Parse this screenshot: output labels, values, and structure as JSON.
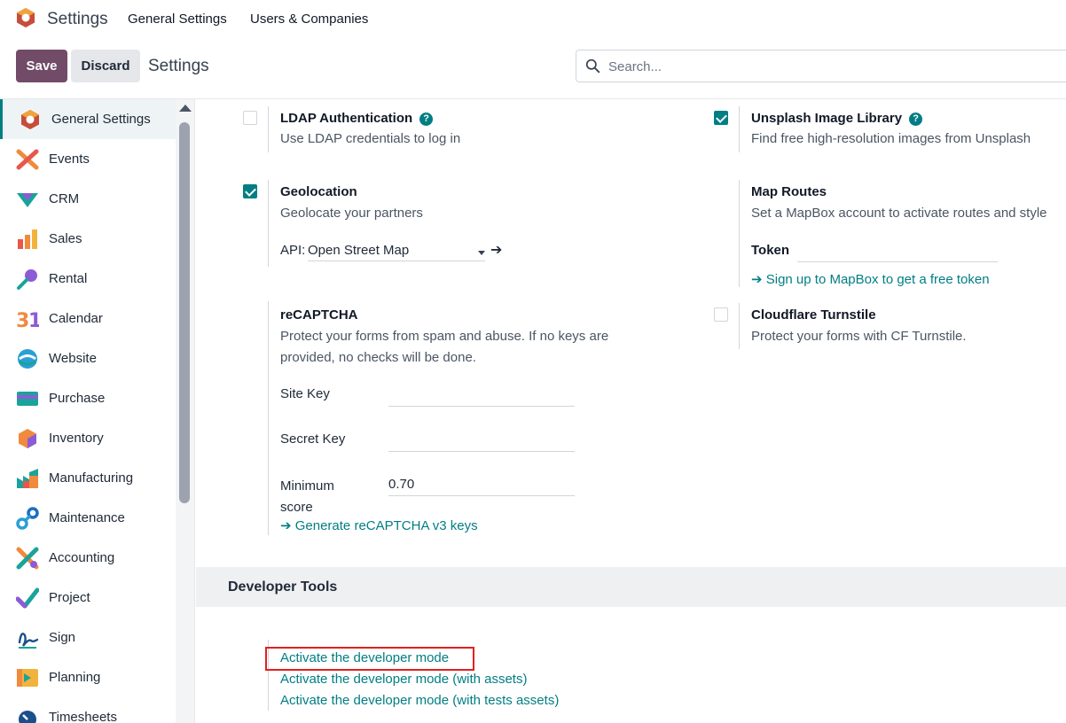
{
  "topnav": {
    "app_title": "Settings",
    "menu": [
      "General Settings",
      "Users & Companies"
    ]
  },
  "control_panel": {
    "save_label": "Save",
    "discard_label": "Discard",
    "breadcrumb": "Settings",
    "search_placeholder": "Search..."
  },
  "sidebar": {
    "items": [
      {
        "label": "General Settings",
        "icon": "settings-icon",
        "active": true
      },
      {
        "label": "Events",
        "icon": "events-icon"
      },
      {
        "label": "CRM",
        "icon": "crm-icon"
      },
      {
        "label": "Sales",
        "icon": "sales-icon"
      },
      {
        "label": "Rental",
        "icon": "rental-icon"
      },
      {
        "label": "Calendar",
        "icon": "calendar-icon"
      },
      {
        "label": "Website",
        "icon": "website-icon"
      },
      {
        "label": "Purchase",
        "icon": "purchase-icon"
      },
      {
        "label": "Inventory",
        "icon": "inventory-icon"
      },
      {
        "label": "Manufacturing",
        "icon": "manufacturing-icon"
      },
      {
        "label": "Maintenance",
        "icon": "maintenance-icon"
      },
      {
        "label": "Accounting",
        "icon": "accounting-icon"
      },
      {
        "label": "Project",
        "icon": "project-icon"
      },
      {
        "label": "Sign",
        "icon": "sign-icon"
      },
      {
        "label": "Planning",
        "icon": "planning-icon"
      },
      {
        "label": "Timesheets",
        "icon": "timesheets-icon"
      }
    ]
  },
  "settings": {
    "ldap": {
      "title": "LDAP Authentication",
      "help": "?",
      "desc": "Use LDAP credentials to log in",
      "checked": false
    },
    "unsplash": {
      "title": "Unsplash Image Library",
      "help": "?",
      "desc": "Find free high-resolution images from Unsplash",
      "checked": true
    },
    "geolocation": {
      "title": "Geolocation",
      "desc": "Geolocate your partners",
      "checked": true,
      "api_label": "API:",
      "api_value": "Open Street Map",
      "arrow": "➔"
    },
    "map_routes": {
      "title": "Map Routes",
      "desc": "Set a MapBox account to activate routes and style",
      "token_label": "Token",
      "link": "➔ Sign up to MapBox to get a free token"
    },
    "recaptcha": {
      "title": "reCAPTCHA",
      "desc": "Protect your forms from spam and abuse. If no keys are provided, no checks will be done.",
      "site_key_label": "Site Key",
      "secret_key_label": "Secret Key",
      "min_score_label": "Minimum score",
      "min_score_value": "0.70",
      "link": "➔ Generate reCAPTCHA v3 keys"
    },
    "cloudflare": {
      "title": "Cloudflare Turnstile",
      "desc": "Protect your forms with CF Turnstile.",
      "checked": false
    }
  },
  "developer_tools": {
    "heading": "Developer Tools",
    "links": [
      "Activate the developer mode",
      "Activate the developer mode (with assets)",
      "Activate the developer mode (with tests assets)"
    ]
  },
  "colors": {
    "brand": "#714b67",
    "accent": "#017e84",
    "highlight": "#e02020"
  }
}
